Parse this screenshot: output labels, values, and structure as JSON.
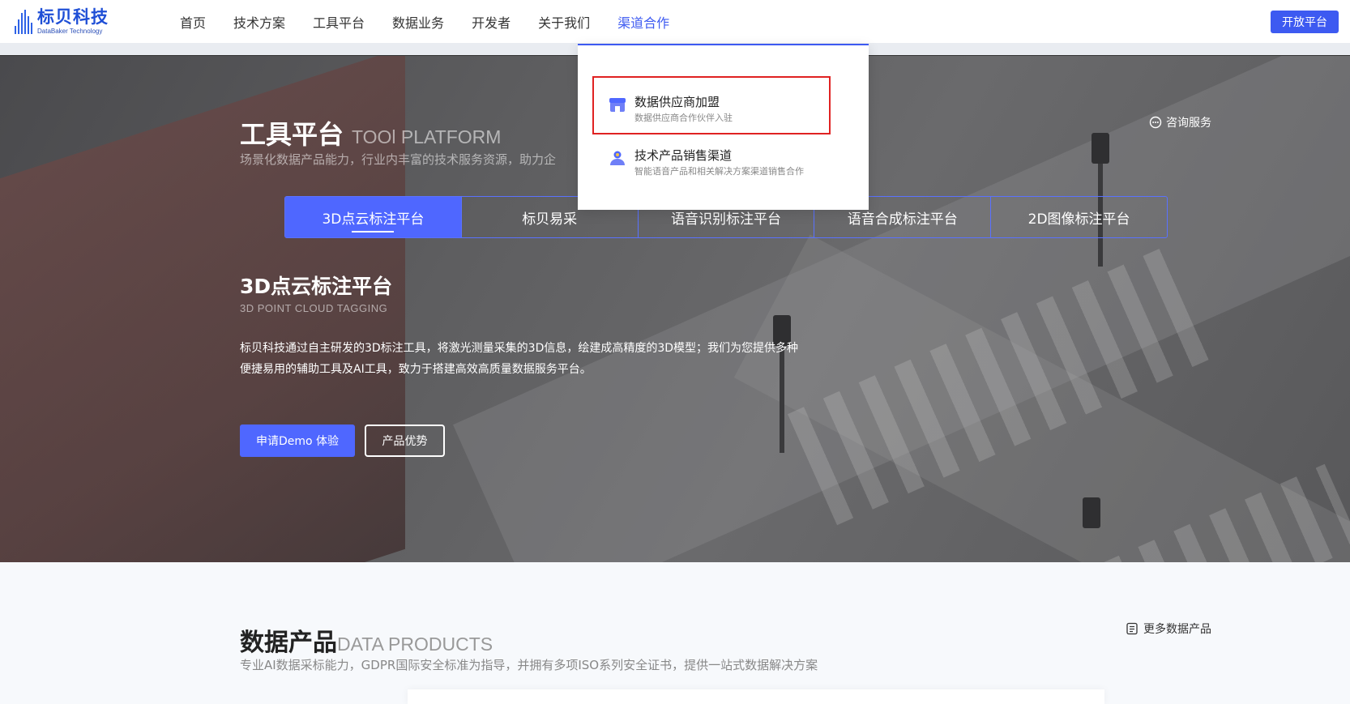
{
  "header": {
    "logo_cn": "标贝科技",
    "logo_en": "DataBaker Technology",
    "nav": [
      "首页",
      "技术方案",
      "工具平台",
      "数据业务",
      "开发者",
      "关于我们",
      "渠道合作"
    ],
    "active_nav": "渠道合作",
    "open_platform": "开放平台"
  },
  "dropdown": {
    "items": [
      {
        "title": "数据供应商加盟",
        "subtitle": "数据供应商合作伙伴入驻"
      },
      {
        "title": "技术产品销售渠道",
        "subtitle": "智能语音产品和相关解决方案渠道销售合作"
      }
    ]
  },
  "hero": {
    "title_cn": "工具平台",
    "title_en": "TOOl PLATFORM",
    "subtitle": "场景化数据产品能力，行业内丰富的技术服务资源，助力企",
    "consult": "咨询服务",
    "tabs": [
      "3D点云标注平台",
      "标贝易采",
      "语音识别标注平台",
      "语音合成标注平台",
      "2D图像标注平台"
    ],
    "active_tab": "3D点云标注平台",
    "product_title": "3D点云标注平台",
    "product_en": "3D POINT CLOUD TAGGING",
    "product_desc": "标贝科技通过自主研发的3D标注工具，将激光测量采集的3D信息，绘建成高精度的3D模型；我们为您提供多种便捷易用的辅助工具及AI工具，致力于搭建高效高质量数据服务平台。",
    "btn_demo": "申请Demo 体验",
    "btn_advantage": "产品优势"
  },
  "data_products": {
    "title_cn": "数据产品",
    "title_en": "DATA PRODUCTS",
    "subtitle": "专业AI数据采标能力，GDPR国际安全标准为指导，并拥有多项ISO系列安全证书，提供一站式数据解决方案",
    "more": "更多数据产品"
  },
  "colors": {
    "accent": "#3d5af1",
    "highlight": "#e02222"
  }
}
